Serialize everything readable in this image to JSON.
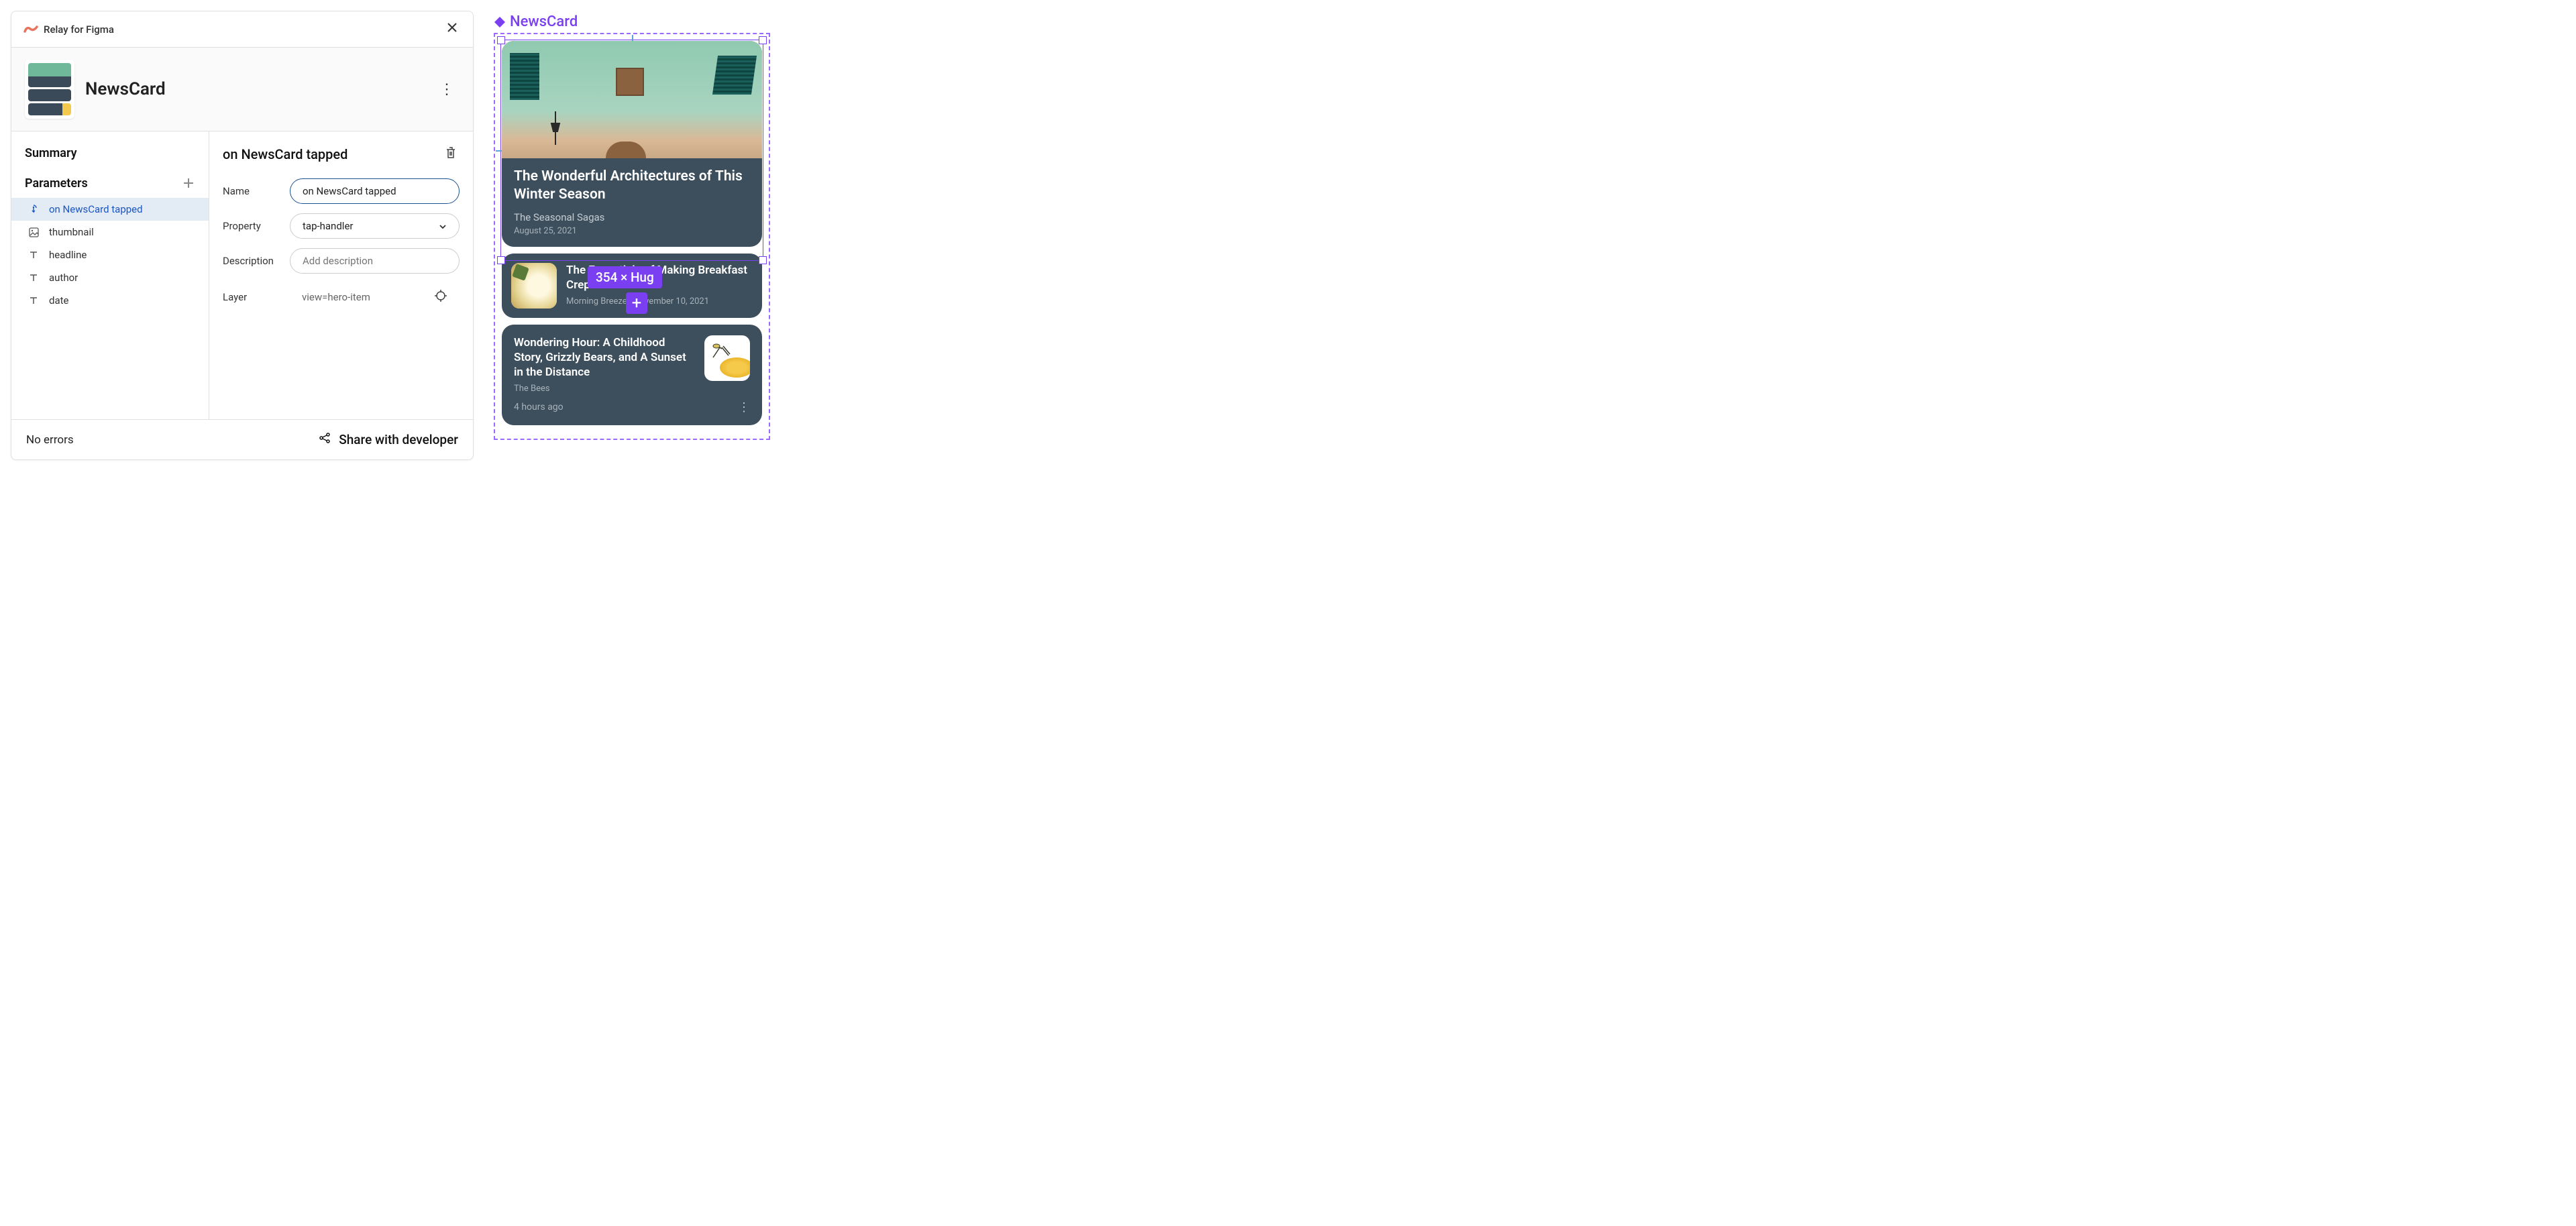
{
  "plugin": {
    "title": "Relay for Figma",
    "component_name": "NewsCard"
  },
  "sidebar": {
    "summary_label": "Summary",
    "parameters_label": "Parameters",
    "params": [
      {
        "label": "on NewsCard tapped"
      },
      {
        "label": "thumbnail"
      },
      {
        "label": "headline"
      },
      {
        "label": "author"
      },
      {
        "label": "date"
      }
    ]
  },
  "detail": {
    "title": "on NewsCard tapped",
    "name_label": "Name",
    "name_value": "on NewsCard tapped",
    "property_label": "Property",
    "property_value": "tap-handler",
    "description_label": "Description",
    "description_placeholder": "Add description",
    "layer_label": "Layer",
    "layer_value": "view=hero-item"
  },
  "footer": {
    "status": "No errors",
    "share": "Share with developer"
  },
  "canvas": {
    "component_label": "NewsCard",
    "size_badge": "354 × Hug",
    "cards": [
      {
        "headline": "The Wonderful Architectures of This Winter Season",
        "author": "The Seasonal Sagas",
        "date": "August 25, 2021"
      },
      {
        "headline": "The Essentials of Making Breakfast Crepes",
        "author": "Morning Breeze",
        "date": "November 10, 2021"
      },
      {
        "headline": "Wondering Hour: A Childhood Story, Grizzly Bears, and A Sunset in the Distance",
        "author": "The Bees",
        "date": "4 hours ago"
      }
    ]
  }
}
